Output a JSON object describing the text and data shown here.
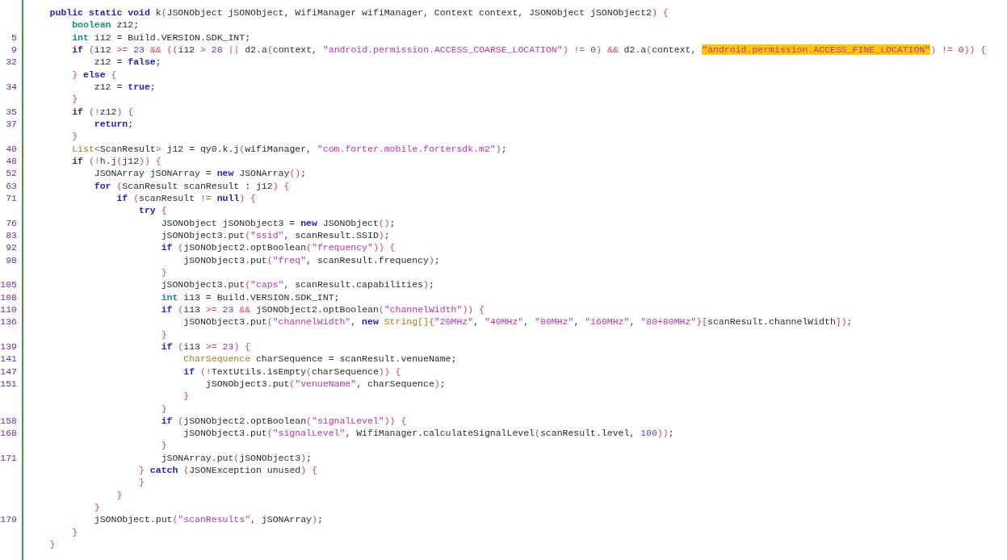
{
  "editor": {
    "lines": [
      {
        "tokens": [
          {
            "kind": "kw",
            "text": "    public static void"
          },
          {
            "kind": "p",
            "text": " k"
          },
          {
            "kind": "br",
            "text": "("
          },
          {
            "kind": "p",
            "text": "JSONObject jSONObject, WifiManager wifiManager, Context context, JSONObject jSONObject2"
          },
          {
            "kind": "br",
            "text": ") {"
          }
        ]
      },
      {
        "tokens": [
          {
            "kind": "type",
            "text": "        boolean"
          },
          {
            "kind": "p",
            "text": " z12;"
          }
        ]
      },
      {
        "number": "5",
        "tokens": [
          {
            "kind": "type",
            "text": "        int"
          },
          {
            "kind": "p",
            "text": " i12 = Build.VERSION.SDK_INT;"
          }
        ]
      },
      {
        "number": "9",
        "tokens": [
          {
            "kind": "kw",
            "text": "        if "
          },
          {
            "kind": "br",
            "text": "("
          },
          {
            "kind": "p",
            "text": "i12 "
          },
          {
            "kind": "op",
            "text": ">= "
          },
          {
            "kind": "num",
            "text": "23 "
          },
          {
            "kind": "op",
            "text": "&& "
          },
          {
            "kind": "br",
            "text": "(("
          },
          {
            "kind": "p",
            "text": "i12 "
          },
          {
            "kind": "op",
            "text": "> "
          },
          {
            "kind": "num",
            "text": "28 "
          },
          {
            "kind": "op",
            "text": "||"
          },
          {
            "kind": "p",
            "text": " d2.a"
          },
          {
            "kind": "br",
            "text": "("
          },
          {
            "kind": "p",
            "text": "context, "
          },
          {
            "kind": "str",
            "text": "\"android.permission.ACCESS_COARSE_LOCATION\""
          },
          {
            "kind": "br",
            "text": ") "
          },
          {
            "kind": "op",
            "text": "!= "
          },
          {
            "kind": "num",
            "text": "0"
          },
          {
            "kind": "br",
            "text": ") "
          },
          {
            "kind": "op",
            "text": "&&"
          },
          {
            "kind": "p",
            "text": " d2.a"
          },
          {
            "kind": "br",
            "text": "("
          },
          {
            "kind": "p",
            "text": "context, "
          },
          {
            "kind": "hl",
            "text": "\"android.permission.ACCESS_FINE_LOCATION\""
          },
          {
            "kind": "br",
            "text": ") "
          },
          {
            "kind": "op",
            "text": "!= "
          },
          {
            "kind": "num",
            "text": "0"
          },
          {
            "kind": "br",
            "text": ")) {"
          }
        ]
      },
      {
        "number": "32",
        "tokens": [
          {
            "kind": "p",
            "text": "            z12 = "
          },
          {
            "kind": "kw",
            "text": "false"
          },
          {
            "kind": "p",
            "text": ";"
          }
        ]
      },
      {
        "tokens": [
          {
            "kind": "br",
            "text": "        } "
          },
          {
            "kind": "kw",
            "text": "else "
          },
          {
            "kind": "br",
            "text": "{"
          }
        ]
      },
      {
        "number": "34",
        "tokens": [
          {
            "kind": "p",
            "text": "            z12 = "
          },
          {
            "kind": "kw",
            "text": "true"
          },
          {
            "kind": "p",
            "text": ";"
          }
        ]
      },
      {
        "tokens": [
          {
            "kind": "br",
            "text": "        }"
          }
        ]
      },
      {
        "number": "35",
        "tokens": [
          {
            "kind": "kw",
            "text": "        if "
          },
          {
            "kind": "br",
            "text": "("
          },
          {
            "kind": "op",
            "text": "!"
          },
          {
            "kind": "p",
            "text": "z12"
          },
          {
            "kind": "br",
            "text": ") {"
          }
        ]
      },
      {
        "number": "37",
        "tokens": [
          {
            "kind": "kw",
            "text": "            return"
          },
          {
            "kind": "p",
            "text": ";"
          }
        ]
      },
      {
        "tokens": [
          {
            "kind": "br",
            "text": "        }"
          }
        ]
      },
      {
        "number": "40",
        "tokens": [
          {
            "kind": "cls",
            "text": "        List"
          },
          {
            "kind": "op",
            "text": "<"
          },
          {
            "kind": "p",
            "text": "ScanResult"
          },
          {
            "kind": "op",
            "text": ">"
          },
          {
            "kind": "p",
            "text": " j12 = qy0.k.j"
          },
          {
            "kind": "br",
            "text": "("
          },
          {
            "kind": "p",
            "text": "wifiManager, "
          },
          {
            "kind": "str",
            "text": "\"com.forter.mobile.fortersdk.m2\""
          },
          {
            "kind": "br",
            "text": ")"
          },
          {
            "kind": "p",
            "text": ";"
          }
        ]
      },
      {
        "number": "48",
        "tokens": [
          {
            "kind": "kw",
            "text": "        if "
          },
          {
            "kind": "br",
            "text": "("
          },
          {
            "kind": "op",
            "text": "!"
          },
          {
            "kind": "p",
            "text": "h.j"
          },
          {
            "kind": "br",
            "text": "("
          },
          {
            "kind": "p",
            "text": "j12"
          },
          {
            "kind": "br",
            "text": ")) {"
          }
        ]
      },
      {
        "number": "52",
        "tokens": [
          {
            "kind": "p",
            "text": "            JSONArray jSONArray = "
          },
          {
            "kind": "kw",
            "text": "new"
          },
          {
            "kind": "p",
            "text": " JSONArray"
          },
          {
            "kind": "br",
            "text": "()"
          },
          {
            "kind": "p",
            "text": ";"
          }
        ]
      },
      {
        "number": "63",
        "tokens": [
          {
            "kind": "kw",
            "text": "            for "
          },
          {
            "kind": "br",
            "text": "("
          },
          {
            "kind": "p",
            "text": "ScanResult scanResult : j12"
          },
          {
            "kind": "br",
            "text": ") {"
          }
        ]
      },
      {
        "number": "71",
        "tokens": [
          {
            "kind": "kw",
            "text": "                if "
          },
          {
            "kind": "br",
            "text": "("
          },
          {
            "kind": "p",
            "text": "scanResult "
          },
          {
            "kind": "op",
            "text": "!= "
          },
          {
            "kind": "kw",
            "text": "null"
          },
          {
            "kind": "br",
            "text": ") {"
          }
        ]
      },
      {
        "tokens": [
          {
            "kind": "kw",
            "text": "                    try "
          },
          {
            "kind": "br",
            "text": "{"
          }
        ]
      },
      {
        "number": "76",
        "tokens": [
          {
            "kind": "p",
            "text": "                        JSONObject jSONObject3 = "
          },
          {
            "kind": "kw",
            "text": "new"
          },
          {
            "kind": "p",
            "text": " JSONObject"
          },
          {
            "kind": "br",
            "text": "()"
          },
          {
            "kind": "p",
            "text": ";"
          }
        ]
      },
      {
        "number": "83",
        "tokens": [
          {
            "kind": "p",
            "text": "                        jSONObject3.put"
          },
          {
            "kind": "br",
            "text": "("
          },
          {
            "kind": "str",
            "text": "\"ssid\""
          },
          {
            "kind": "p",
            "text": ", scanResult.SSID"
          },
          {
            "kind": "br",
            "text": ")"
          },
          {
            "kind": "p",
            "text": ";"
          }
        ]
      },
      {
        "number": "92",
        "tokens": [
          {
            "kind": "kw",
            "text": "                        if "
          },
          {
            "kind": "br",
            "text": "("
          },
          {
            "kind": "p",
            "text": "jSONObject2.optBoolean"
          },
          {
            "kind": "br",
            "text": "("
          },
          {
            "kind": "str",
            "text": "\"frequency\""
          },
          {
            "kind": "br",
            "text": ")) {"
          }
        ]
      },
      {
        "number": "98",
        "tokens": [
          {
            "kind": "p",
            "text": "                            jSONObject3.put"
          },
          {
            "kind": "br",
            "text": "("
          },
          {
            "kind": "str",
            "text": "\"freq\""
          },
          {
            "kind": "p",
            "text": ", scanResult.frequency"
          },
          {
            "kind": "br",
            "text": ")"
          },
          {
            "kind": "p",
            "text": ";"
          }
        ]
      },
      {
        "tokens": [
          {
            "kind": "br",
            "text": "                        }"
          }
        ]
      },
      {
        "number": "105",
        "tokens": [
          {
            "kind": "p",
            "text": "                        jSONObject3.put"
          },
          {
            "kind": "br",
            "text": "("
          },
          {
            "kind": "str",
            "text": "\"caps\""
          },
          {
            "kind": "p",
            "text": ", scanResult.capabilities"
          },
          {
            "kind": "br",
            "text": ")"
          },
          {
            "kind": "p",
            "text": ";"
          }
        ]
      },
      {
        "number": "108",
        "tokens": [
          {
            "kind": "type",
            "text": "                        int"
          },
          {
            "kind": "p",
            "text": " i13 = Build.VERSION.SDK_INT;"
          }
        ]
      },
      {
        "number": "110",
        "tokens": [
          {
            "kind": "kw",
            "text": "                        if "
          },
          {
            "kind": "br",
            "text": "("
          },
          {
            "kind": "p",
            "text": "i13 "
          },
          {
            "kind": "op",
            "text": ">= "
          },
          {
            "kind": "num",
            "text": "23 "
          },
          {
            "kind": "op",
            "text": "&&"
          },
          {
            "kind": "p",
            "text": " jSONObject2.optBoolean"
          },
          {
            "kind": "br",
            "text": "("
          },
          {
            "kind": "str",
            "text": "\"channelWidth\""
          },
          {
            "kind": "br",
            "text": ")) {"
          }
        ]
      },
      {
        "number": "136",
        "tokens": [
          {
            "kind": "p",
            "text": "                            jSONObject3.put"
          },
          {
            "kind": "br",
            "text": "("
          },
          {
            "kind": "str",
            "text": "\"channelWidth\""
          },
          {
            "kind": "p",
            "text": ", "
          },
          {
            "kind": "kw",
            "text": "new "
          },
          {
            "kind": "cls",
            "text": "String[]"
          },
          {
            "kind": "br",
            "text": "{"
          },
          {
            "kind": "str",
            "text": "\"20MHz\""
          },
          {
            "kind": "p",
            "text": ", "
          },
          {
            "kind": "str",
            "text": "\"40MHz\""
          },
          {
            "kind": "p",
            "text": ", "
          },
          {
            "kind": "str",
            "text": "\"80MHz\""
          },
          {
            "kind": "p",
            "text": ", "
          },
          {
            "kind": "str",
            "text": "\"160MHz\""
          },
          {
            "kind": "p",
            "text": ", "
          },
          {
            "kind": "str",
            "text": "\"80+80MHz\""
          },
          {
            "kind": "br",
            "text": "}["
          },
          {
            "kind": "p",
            "text": "scanResult.channelWidth"
          },
          {
            "kind": "br",
            "text": "])"
          },
          {
            "kind": "p",
            "text": ";"
          }
        ]
      },
      {
        "tokens": [
          {
            "kind": "br",
            "text": "                        }"
          }
        ]
      },
      {
        "number": "139",
        "tokens": [
          {
            "kind": "kw",
            "text": "                        if "
          },
          {
            "kind": "br",
            "text": "("
          },
          {
            "kind": "p",
            "text": "i13 "
          },
          {
            "kind": "op",
            "text": ">= "
          },
          {
            "kind": "num",
            "text": "23"
          },
          {
            "kind": "br",
            "text": ") {"
          }
        ]
      },
      {
        "number": "141",
        "tokens": [
          {
            "kind": "cls",
            "text": "                            CharSequence"
          },
          {
            "kind": "p",
            "text": " charSequence = scanResult.venueName;"
          }
        ]
      },
      {
        "number": "147",
        "tokens": [
          {
            "kind": "kw",
            "text": "                            if "
          },
          {
            "kind": "br",
            "text": "("
          },
          {
            "kind": "op",
            "text": "!"
          },
          {
            "kind": "p",
            "text": "TextUtils.isEmpty"
          },
          {
            "kind": "br",
            "text": "("
          },
          {
            "kind": "p",
            "text": "charSequence"
          },
          {
            "kind": "br",
            "text": ")) {"
          }
        ]
      },
      {
        "number": "151",
        "tokens": [
          {
            "kind": "p",
            "text": "                                jSONObject3.put"
          },
          {
            "kind": "br",
            "text": "("
          },
          {
            "kind": "str",
            "text": "\"venueName\""
          },
          {
            "kind": "p",
            "text": ", charSequence"
          },
          {
            "kind": "br",
            "text": ")"
          },
          {
            "kind": "p",
            "text": ";"
          }
        ]
      },
      {
        "tokens": [
          {
            "kind": "br",
            "text": "                            }"
          }
        ]
      },
      {
        "tokens": [
          {
            "kind": "br",
            "text": "                        }"
          }
        ]
      },
      {
        "number": "158",
        "tokens": [
          {
            "kind": "kw",
            "text": "                        if "
          },
          {
            "kind": "br",
            "text": "("
          },
          {
            "kind": "p",
            "text": "jSONObject2.optBoolean"
          },
          {
            "kind": "br",
            "text": "("
          },
          {
            "kind": "str",
            "text": "\"signalLevel\""
          },
          {
            "kind": "br",
            "text": ")) {"
          }
        ]
      },
      {
        "number": "168",
        "tokens": [
          {
            "kind": "p",
            "text": "                            jSONObject3.put"
          },
          {
            "kind": "br",
            "text": "("
          },
          {
            "kind": "str",
            "text": "\"signalLevel\""
          },
          {
            "kind": "p",
            "text": ", WifiManager.calculateSignalLevel"
          },
          {
            "kind": "br",
            "text": "("
          },
          {
            "kind": "p",
            "text": "scanResult.level, "
          },
          {
            "kind": "num",
            "text": "100"
          },
          {
            "kind": "br",
            "text": "))"
          },
          {
            "kind": "p",
            "text": ";"
          }
        ]
      },
      {
        "tokens": [
          {
            "kind": "br",
            "text": "                        }"
          }
        ]
      },
      {
        "number": "171",
        "tokens": [
          {
            "kind": "p",
            "text": "                        jSONArray.put"
          },
          {
            "kind": "br",
            "text": "("
          },
          {
            "kind": "p",
            "text": "jSONObject3"
          },
          {
            "kind": "br",
            "text": ")"
          },
          {
            "kind": "p",
            "text": ";"
          }
        ]
      },
      {
        "tokens": [
          {
            "kind": "br",
            "text": "                    } "
          },
          {
            "kind": "kw",
            "text": "catch "
          },
          {
            "kind": "br",
            "text": "("
          },
          {
            "kind": "p",
            "text": "JSONException unused"
          },
          {
            "kind": "br",
            "text": ") {"
          }
        ]
      },
      {
        "tokens": [
          {
            "kind": "br",
            "text": "                    }"
          }
        ]
      },
      {
        "tokens": [
          {
            "kind": "br",
            "text": "                }"
          }
        ]
      },
      {
        "tokens": [
          {
            "kind": "br",
            "text": "            }"
          }
        ]
      },
      {
        "number": "179",
        "tokens": [
          {
            "kind": "p",
            "text": "            jSONObject.put"
          },
          {
            "kind": "br",
            "text": "("
          },
          {
            "kind": "str",
            "text": "\"scanResults\""
          },
          {
            "kind": "p",
            "text": ", jSONArray"
          },
          {
            "kind": "br",
            "text": ")"
          },
          {
            "kind": "p",
            "text": ";"
          }
        ]
      },
      {
        "tokens": [
          {
            "kind": "br",
            "text": "        }"
          }
        ]
      },
      {
        "tokens": [
          {
            "kind": "br",
            "text": "    }"
          }
        ]
      }
    ]
  }
}
